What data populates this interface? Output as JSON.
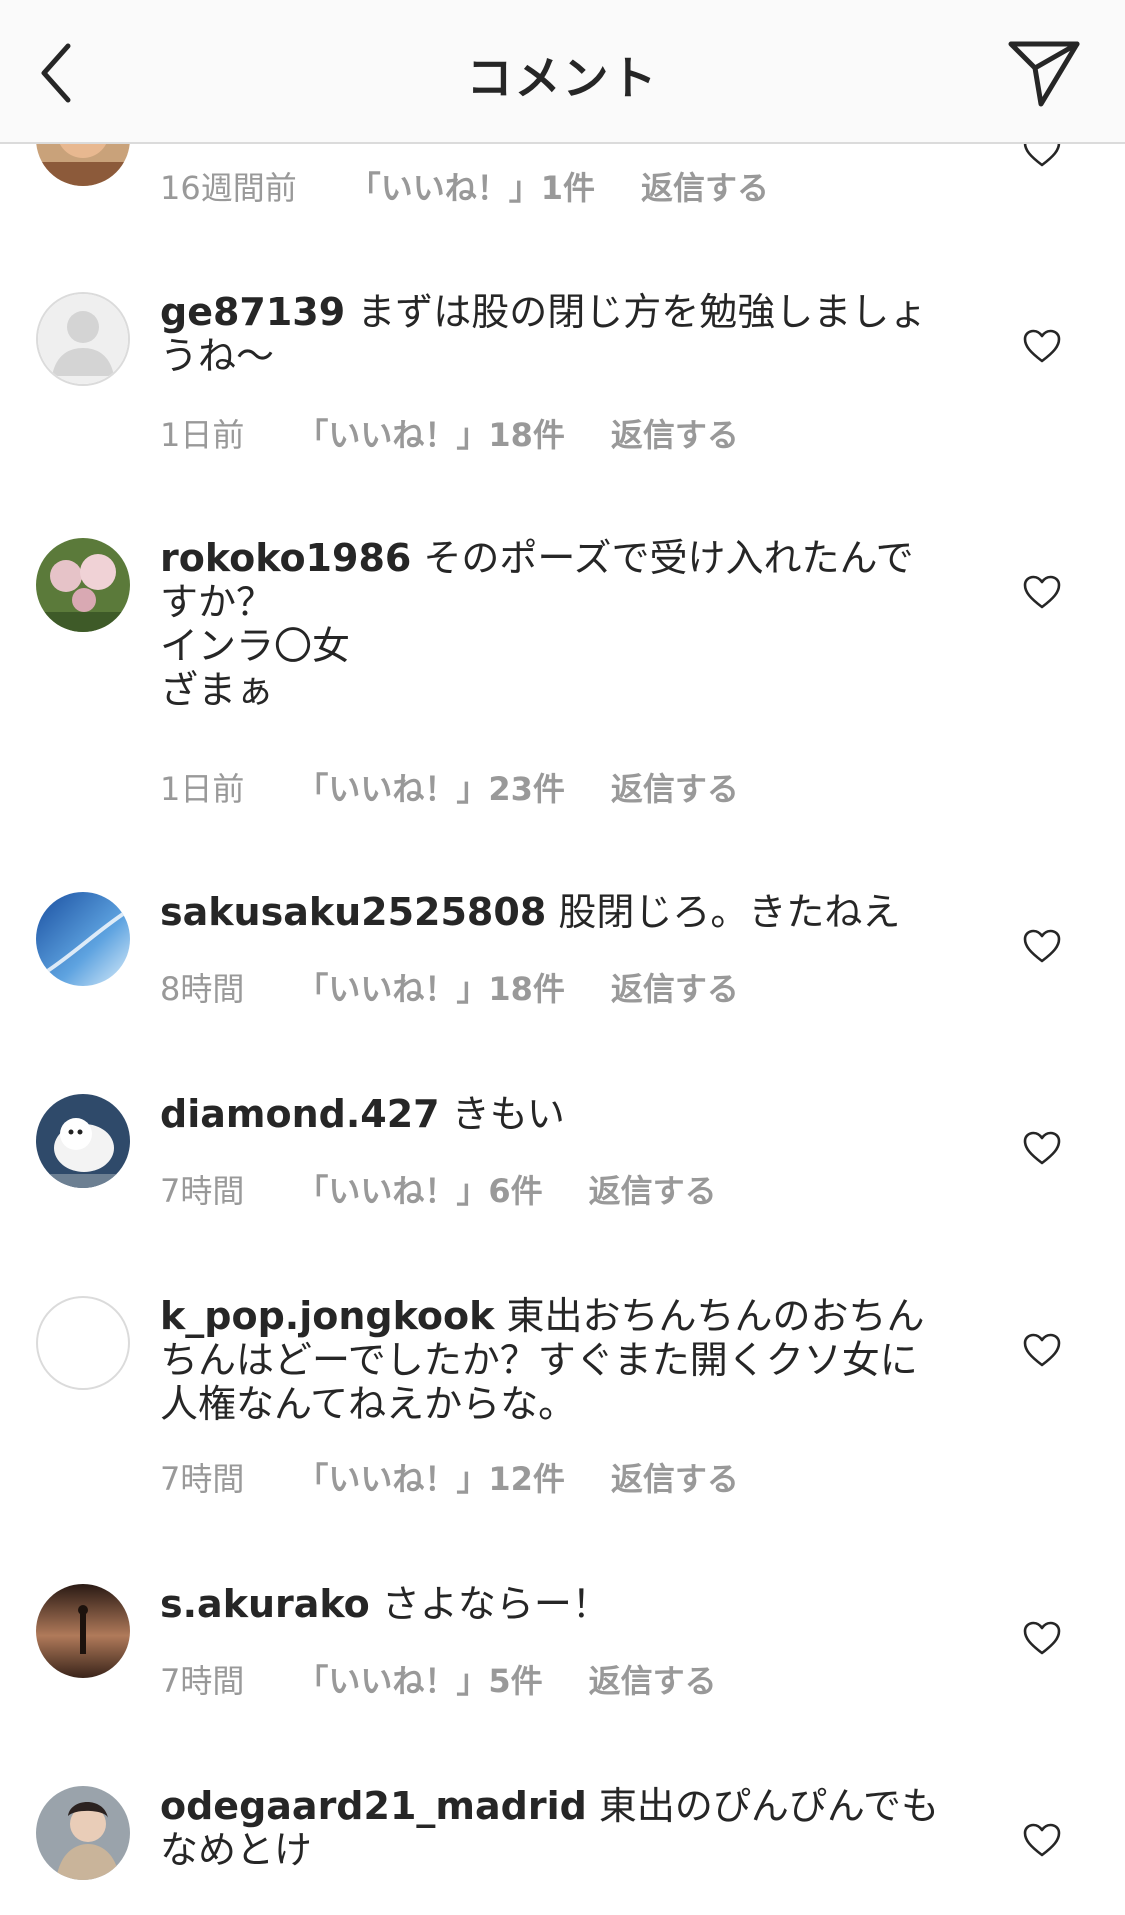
{
  "header": {
    "title": "コメント"
  },
  "icons": {
    "back": "chevron-left-icon",
    "send": "paper-plane-icon",
    "like": "heart-outline-icon"
  },
  "comments": [
    {
      "username": "",
      "text": "",
      "time": "16週間前",
      "likes": "「いいね！」1件",
      "reply": "返信する"
    },
    {
      "username": "ge87139",
      "text": "まずは股の閉じ方を勉強しましょうね〜",
      "time": "1日前",
      "likes": "「いいね！」18件",
      "reply": "返信する"
    },
    {
      "username": "rokoko1986",
      "text": "そのポーズで受け入れたんですか？\nインラ〇女\nざまぁ",
      "time": "1日前",
      "likes": "「いいね！」23件",
      "reply": "返信する"
    },
    {
      "username": "sakusaku2525808",
      "text": "股閉じろ。きたねえ",
      "time": "8時間",
      "likes": "「いいね！」18件",
      "reply": "返信する"
    },
    {
      "username": "diamond.427",
      "text": "きもい",
      "time": "7時間",
      "likes": "「いいね！」6件",
      "reply": "返信する"
    },
    {
      "username": "k_pop.jongkook",
      "text": "東出おちんちんのおちんちんはどーでしたか？すぐまた開くクソ女に人権なんてねえからな。",
      "time": "7時間",
      "likes": "「いいね！」12件",
      "reply": "返信する"
    },
    {
      "username": "s.akurako",
      "text": "さよならー！",
      "time": "7時間",
      "likes": "「いいね！」5件",
      "reply": "返信する"
    },
    {
      "username": "odegaard21_madrid",
      "text": "東出のぴんぴんでもなめとけ",
      "time": "",
      "likes": "",
      "reply": ""
    }
  ]
}
